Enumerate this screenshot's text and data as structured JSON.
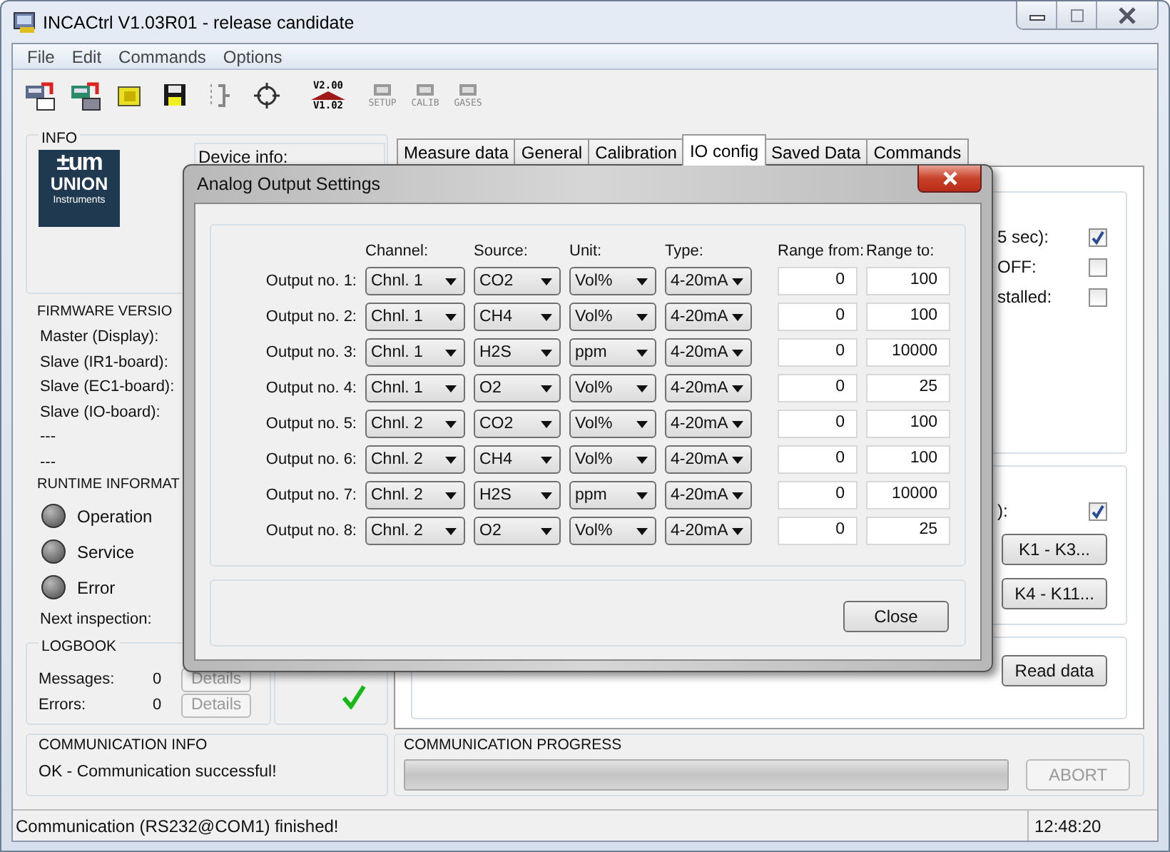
{
  "window": {
    "title": "INCACtrl V1.03R01 - release candidate"
  },
  "menu": [
    "File",
    "Edit",
    "Commands",
    "Options"
  ],
  "toolbar": [
    {
      "kind": "read"
    },
    {
      "kind": "write"
    },
    {
      "kind": "open"
    },
    {
      "kind": "save"
    },
    {
      "kind": "numbering"
    },
    {
      "kind": "target"
    },
    {
      "kind": "version",
      "labels": [
        "V2.00",
        "V1.02"
      ]
    },
    {
      "kind": "chip",
      "label": "SETUP",
      "disabled": true
    },
    {
      "kind": "chip",
      "label": "CALIB",
      "disabled": true
    },
    {
      "kind": "chip",
      "label": "GASES",
      "disabled": true
    }
  ],
  "info": {
    "title": "INFO",
    "logo": {
      "mark": "±um",
      "name": "UNION",
      "tagline": "Instruments"
    },
    "device_info_label": "Device info:"
  },
  "firmware": {
    "title": "FIRMWARE VERSIO",
    "rows": [
      "Master (Display):",
      "Slave (IR1-board):",
      "Slave (EC1-board):",
      "Slave (IO-board):",
      "---",
      "---"
    ]
  },
  "runtime": {
    "title": "RUNTIME INFORMAT",
    "lamps": [
      {
        "label": "Operation",
        "on": false
      },
      {
        "label": "Service",
        "on": false
      },
      {
        "label": "Error",
        "on": false
      }
    ],
    "next_inspection": "Next inspection:"
  },
  "logbook": {
    "title": "LOGBOOK",
    "rows": [
      {
        "label": "Messages:",
        "count": "0",
        "button": "Details"
      },
      {
        "label": "Errors:",
        "count": "0",
        "button": "Details"
      }
    ],
    "status_ok": true
  },
  "tabs": [
    {
      "label": "Measure data",
      "selected": false
    },
    {
      "label": "General",
      "selected": false
    },
    {
      "label": "Calibration",
      "selected": false
    },
    {
      "label": "IO config",
      "selected": true
    },
    {
      "label": "Saved Data",
      "selected": false
    },
    {
      "label": "Commands",
      "selected": false
    }
  ],
  "io_config": {
    "options": [
      {
        "label": "5 sec):",
        "checked": true
      },
      {
        "label": "OFF:",
        "checked": false
      },
      {
        "label": "stalled:",
        "checked": false
      }
    ],
    "relay_option": {
      "label": "):",
      "checked": true
    },
    "relay_buttons": [
      "K1 - K3...",
      "K4 - K11..."
    ],
    "read_button": "Read data"
  },
  "communication_info": {
    "title": "COMMUNICATION INFO",
    "message": "OK - Communication successful!"
  },
  "communication_progress": {
    "title": "COMMUNICATION PROGRESS",
    "level": 1,
    "abort_button": {
      "label": "ABORT",
      "disabled": true
    }
  },
  "status_bar": {
    "message": "Communication (RS232@COM1) finished!",
    "time": "12:48:20"
  },
  "dialog": {
    "title": "Analog Output Settings",
    "columns": [
      "Channel:",
      "Source:",
      "Unit:",
      "Type:",
      "Range from:",
      "Range to:"
    ],
    "outputs": [
      {
        "label": "Output no. 1:",
        "channel": "Chnl. 1",
        "source": "CO2",
        "unit": "Vol%",
        "type": "4-20mA",
        "range_from": "0",
        "range_to": "100"
      },
      {
        "label": "Output no. 2:",
        "channel": "Chnl. 1",
        "source": "CH4",
        "unit": "Vol%",
        "type": "4-20mA",
        "range_from": "0",
        "range_to": "100"
      },
      {
        "label": "Output no. 3:",
        "channel": "Chnl. 1",
        "source": "H2S",
        "unit": "ppm",
        "type": "4-20mA",
        "range_from": "0",
        "range_to": "10000"
      },
      {
        "label": "Output no. 4:",
        "channel": "Chnl. 1",
        "source": "O2",
        "unit": "Vol%",
        "type": "4-20mA",
        "range_from": "0",
        "range_to": "25"
      },
      {
        "label": "Output no. 5:",
        "channel": "Chnl. 2",
        "source": "CO2",
        "unit": "Vol%",
        "type": "4-20mA",
        "range_from": "0",
        "range_to": "100"
      },
      {
        "label": "Output no. 6:",
        "channel": "Chnl. 2",
        "source": "CH4",
        "unit": "Vol%",
        "type": "4-20mA",
        "range_from": "0",
        "range_to": "100"
      },
      {
        "label": "Output no. 7:",
        "channel": "Chnl. 2",
        "source": "H2S",
        "unit": "ppm",
        "type": "4-20mA",
        "range_from": "0",
        "range_to": "10000"
      },
      {
        "label": "Output no. 8:",
        "channel": "Chnl. 2",
        "source": "O2",
        "unit": "Vol%",
        "type": "4-20mA",
        "range_from": "0",
        "range_to": "25"
      }
    ],
    "close_button": "Close"
  }
}
